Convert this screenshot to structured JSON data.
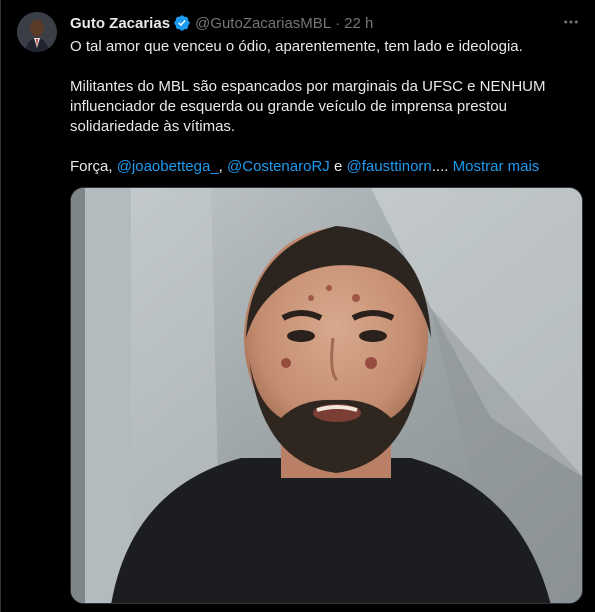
{
  "tweet": {
    "author_name": "Guto Zacarias",
    "handle": "@GutoZacariasMBL",
    "separator": "·",
    "time": "22 h",
    "paragraphs": [
      "O tal amor que venceu o ódio, aparentemente, tem lado e ideologia.",
      "Militantes do MBL são espancados por marginais da UFSC e NENHUM influenciador de esquerda ou grande veículo de imprensa prestou solidariedade às vítimas."
    ],
    "forca_prefix": "Força, ",
    "mentions": [
      "@joaobettega_",
      "@CostenaroRJ",
      "@fausttinorn"
    ],
    "mention_sep": ", ",
    "mention_and": " e ",
    "ellipsis": "....",
    "show_more_label": "Mostrar mais",
    "verified_icon": "verified-badge-icon",
    "more_icon": "more-options-icon",
    "verified_color": "#1d9bf0",
    "link_color": "#1d9bf0"
  }
}
